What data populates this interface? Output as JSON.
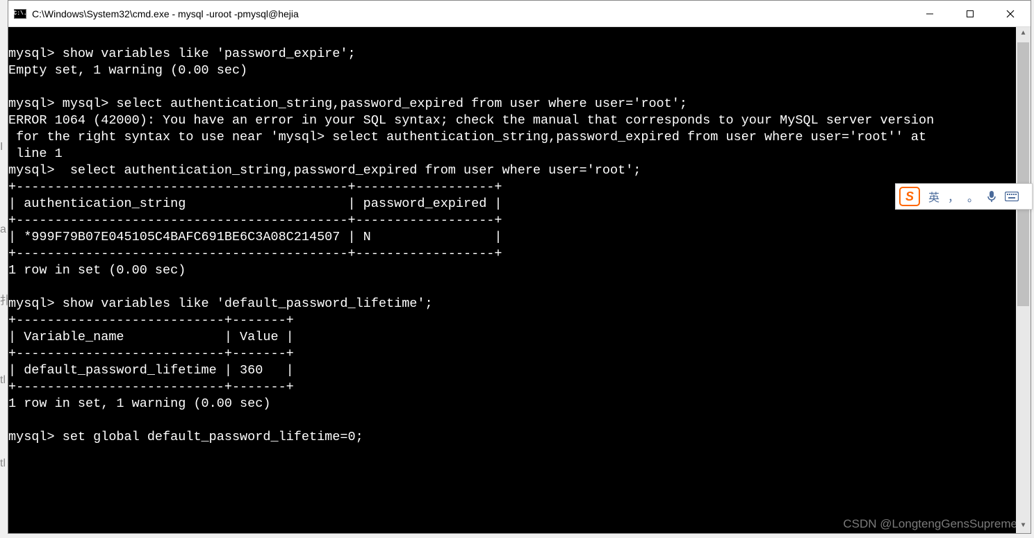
{
  "window": {
    "icon_label": "C:\\.",
    "title": "C:\\Windows\\System32\\cmd.exe - mysql  -uroot -pmysql@hejia"
  },
  "terminal": {
    "lines": [
      "mysql> show variables like 'password_expire';",
      "Empty set, 1 warning (0.00 sec)",
      "",
      "mysql> mysql> select authentication_string,password_expired from user where user='root';",
      "ERROR 1064 (42000): You have an error in your SQL syntax; check the manual that corresponds to your MySQL server version",
      " for the right syntax to use near 'mysql> select authentication_string,password_expired from user where user='root'' at",
      " line 1",
      "mysql>  select authentication_string,password_expired from user where user='root';",
      "+-------------------------------------------+------------------+",
      "| authentication_string                     | password_expired |",
      "+-------------------------------------------+------------------+",
      "| *999F79B07E045105C4BAFC691BE6C3A08C214507 | N                |",
      "+-------------------------------------------+------------------+",
      "1 row in set (0.00 sec)",
      "",
      "mysql> show variables like 'default_password_lifetime';",
      "+---------------------------+-------+",
      "| Variable_name             | Value |",
      "+---------------------------+-------+",
      "| default_password_lifetime | 360   |",
      "+---------------------------+-------+",
      "1 row in set, 1 warning (0.00 sec)",
      "",
      "mysql> set global default_password_lifetime=0;"
    ]
  },
  "ime": {
    "lang": "英",
    "comma": "，",
    "dot": "。"
  },
  "watermark": "CSDN @LongtengGensSupreme",
  "left_fragments": {
    "a": "I",
    "b": "a",
    "c": "扑",
    "d": "tl",
    "e": "tl"
  }
}
